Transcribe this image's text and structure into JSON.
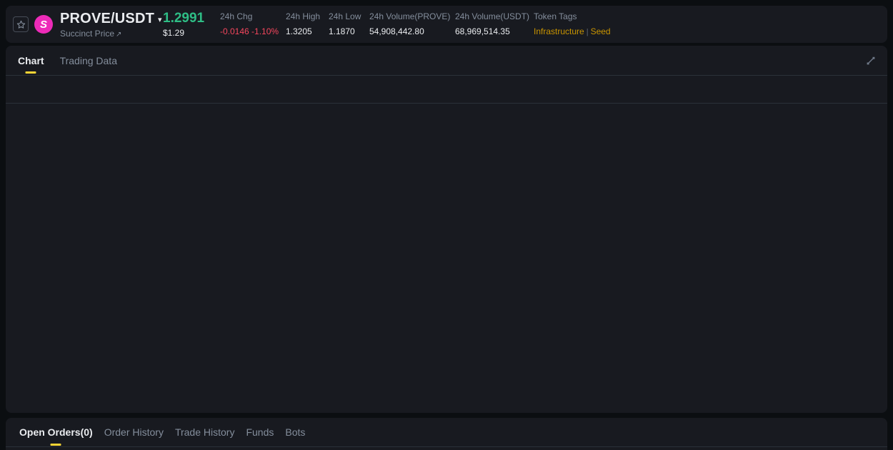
{
  "header": {
    "symbol": "PROVE/USDT",
    "logo_letter": "S",
    "subtitle": "Succinct Price",
    "price": "1.2991",
    "price_usd": "$1.29",
    "stats": [
      {
        "label": "24h Chg",
        "value": "-0.0146 -1.10%"
      },
      {
        "label": "24h High",
        "value": "1.3205"
      },
      {
        "label": "24h Low",
        "value": "1.1870"
      },
      {
        "label": "24h Volume(PROVE)",
        "value": "54,908,442.80"
      },
      {
        "label": "24h Volume(USDT)",
        "value": "68,969,514.35"
      }
    ],
    "token_tags": {
      "label": "Token Tags",
      "separator": "|",
      "tags": [
        "Infrastructure",
        "Seed"
      ]
    }
  },
  "chart_panel": {
    "tabs": [
      {
        "label": "Chart",
        "active": true
      },
      {
        "label": "Trading Data",
        "active": false
      }
    ]
  },
  "orders_panel": {
    "tabs": [
      {
        "label": "Open Orders(0)",
        "active": true
      },
      {
        "label": "Order History",
        "active": false
      },
      {
        "label": "Trade History",
        "active": false
      },
      {
        "label": "Funds",
        "active": false
      },
      {
        "label": "Bots",
        "active": false
      }
    ]
  },
  "icons": {
    "favorite": "star-outline",
    "caret_down": "▾",
    "external_link": "↗",
    "expand": "diagonal-resize"
  },
  "colors": {
    "page_bg": "#0b0e11",
    "card_bg": "#181a20",
    "divider": "#2b3139",
    "text_primary": "#eaecef",
    "text_secondary": "#848e9c",
    "up_green": "#2ebd85",
    "down_red": "#f6465d",
    "accent_yellow": "#fcd535",
    "tag_gold": "#c99400",
    "logo_pink": "#ed2bb8"
  }
}
